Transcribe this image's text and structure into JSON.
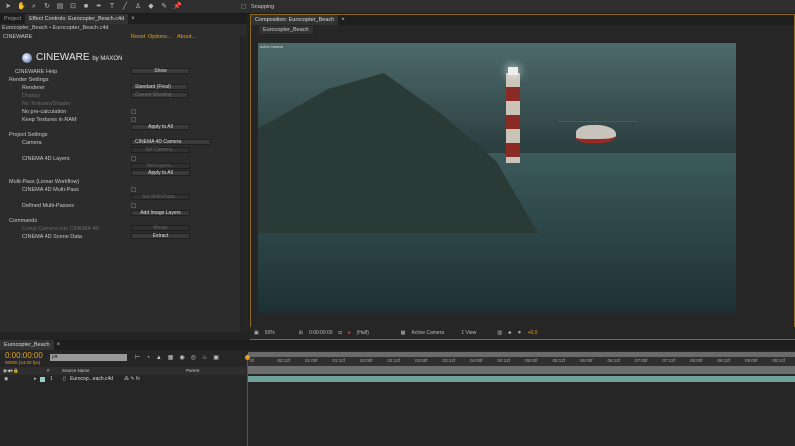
{
  "toolbar": {
    "snapping_label": "Snapping"
  },
  "left_tabs": [
    "Project",
    "Effect Controls: Eurocopter_Beach.c4d"
  ],
  "breadcrumb": "Eurocopter_Beach • Eurocopter_Beach.c4d",
  "effect": {
    "name": "CINEWARE",
    "reset": "Reset",
    "options": "Options...",
    "about": "About...",
    "logo": "CINEWARE by MAXON"
  },
  "rows": {
    "help": "CINEWARE Help",
    "show": "Show",
    "render_settings": "Render Settings",
    "renderer": "Renderer",
    "renderer_value": "Standard (Final)",
    "display": "Display",
    "display_value": "Current Shading",
    "no_textures": "No Textures/Shader",
    "no_precalc": "No pre-calculation",
    "keep_textures": "Keep Textures in RAM",
    "apply1": "Apply to All",
    "project_settings": "Project Settings",
    "camera": "Camera",
    "camera_value": "CINEMA 4D Camera",
    "set_camera": "Set Camera...",
    "c4d_layers": "CINEMA 4D Layers",
    "set_layers": "Set Layers...",
    "apply2": "Apply to All",
    "multipass": "Multi-Pass (Linear Workflow)",
    "c4d_multipass": "CINEMA 4D Multi-Pass",
    "set_multipass": "Set Multi-Pass...",
    "defined_multipasses": "Defined Multi-Passes",
    "add_image_layers": "Add Image Layers",
    "commands": "Commands",
    "comp_camera": "Comp Camera into CINEMA 4D",
    "merge": "Merge",
    "scene_data": "CINEMA 4D Scene Data",
    "extract": "Extract"
  },
  "comp": {
    "tab": "Composition: Eurocopter_Beach",
    "subtab": "Eurocopter_Beach",
    "camera_label": "Active Camera"
  },
  "comp_toolbar": {
    "zoom": "50%",
    "time": "0:00:00:00",
    "resolution": "(Half)",
    "camera": "Active Camera",
    "views": "1 View",
    "exposure": "+0.0"
  },
  "timeline": {
    "tab": "Eurocopter_Beach",
    "timecode": "0:00:00:00",
    "frames": "00000 (24.00 fps)",
    "search_placeholder": "ρ▾",
    "col_source": "Source Name",
    "col_parent": "Parent",
    "col_num": "#",
    "layer": {
      "index": "1",
      "name": "Eurocop...each.c4d"
    },
    "ticks": [
      "0f",
      "00:12f",
      "01:00f",
      "01:12f",
      "02:00f",
      "02:12f",
      "03:00f",
      "03:12f",
      "04:00f",
      "04:12f",
      "05:00f",
      "05:12f",
      "06:00f",
      "06:12f",
      "07:00f",
      "07:12f",
      "08:00f",
      "08:12f",
      "09:00f",
      "09:12f"
    ]
  },
  "colors": {
    "accent": "#e0a020",
    "layer_bar": "#6fa39a",
    "playhead": "#cc2222"
  }
}
